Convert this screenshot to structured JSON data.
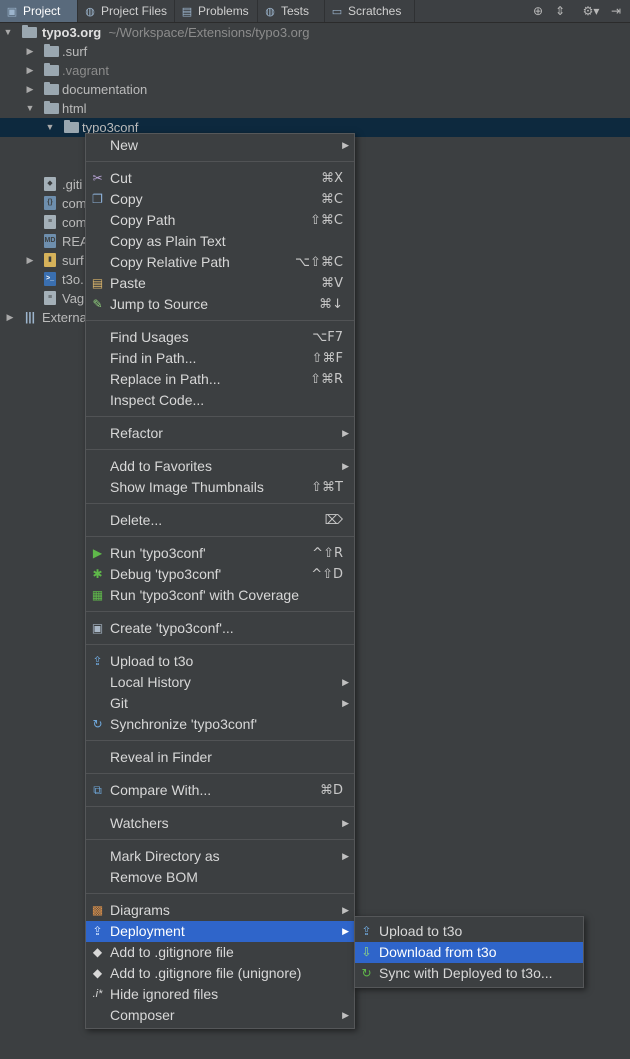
{
  "tabs": [
    {
      "label": "Project",
      "icon": "project-icon"
    },
    {
      "label": "Project Files",
      "icon": "globe-icon"
    },
    {
      "label": "Problems",
      "icon": "problems-icon"
    },
    {
      "label": "Tests",
      "icon": "globe-icon"
    },
    {
      "label": "Scratches",
      "icon": "scratches-icon"
    }
  ],
  "tree": {
    "root": {
      "name": "typo3.org",
      "path": "~/Workspace/Extensions/typo3.org"
    },
    "items": [
      {
        "label": ".surf"
      },
      {
        "label": ".vagrant"
      },
      {
        "label": "documentation"
      },
      {
        "label": "html"
      },
      {
        "label": "typo3conf"
      },
      {
        "label": ".giti"
      },
      {
        "label": "com"
      },
      {
        "label": "com"
      },
      {
        "label": "REA"
      },
      {
        "label": "surf"
      },
      {
        "label": "t3o."
      },
      {
        "label": "Vag"
      },
      {
        "label": "Externa"
      }
    ]
  },
  "context_menu": {
    "new": "New",
    "cut": {
      "label": "Cut",
      "shortcut": "⌘X"
    },
    "copy": {
      "label": "Copy",
      "shortcut": "⌘C"
    },
    "copy_path": {
      "label": "Copy Path",
      "shortcut": "⇧⌘C"
    },
    "copy_plain": {
      "label": "Copy as Plain Text"
    },
    "copy_relative": {
      "label": "Copy Relative Path",
      "shortcut": "⌥⇧⌘C"
    },
    "paste": {
      "label": "Paste",
      "shortcut": "⌘V"
    },
    "jump_source": {
      "label": "Jump to Source",
      "shortcut": "⌘↓"
    },
    "find_usages": {
      "label": "Find Usages",
      "shortcut": "⌥F7"
    },
    "find_in_path": {
      "label": "Find in Path...",
      "shortcut": "⇧⌘F"
    },
    "replace_in_path": {
      "label": "Replace in Path...",
      "shortcut": "⇧⌘R"
    },
    "inspect_code": {
      "label": "Inspect Code..."
    },
    "refactor": {
      "label": "Refactor"
    },
    "add_favorites": {
      "label": "Add to Favorites"
    },
    "show_thumbnails": {
      "label": "Show Image Thumbnails",
      "shortcut": "⇧⌘T"
    },
    "delete": {
      "label": "Delete...",
      "shortcut": "⌦"
    },
    "run": {
      "label": "Run 'typo3conf'",
      "shortcut": "^⇧R"
    },
    "debug": {
      "label": "Debug 'typo3conf'",
      "shortcut": "^⇧D"
    },
    "run_coverage": {
      "label": "Run 'typo3conf' with Coverage"
    },
    "create": {
      "label": "Create 'typo3conf'..."
    },
    "upload": {
      "label": "Upload to t3o"
    },
    "local_history": {
      "label": "Local History"
    },
    "git": {
      "label": "Git"
    },
    "synchronize": {
      "label": "Synchronize 'typo3conf'"
    },
    "reveal_finder": {
      "label": "Reveal in Finder"
    },
    "compare_with": {
      "label": "Compare With...",
      "shortcut": "⌘D"
    },
    "watchers": {
      "label": "Watchers"
    },
    "mark_directory": {
      "label": "Mark Directory as"
    },
    "remove_bom": {
      "label": "Remove BOM"
    },
    "diagrams": {
      "label": "Diagrams"
    },
    "deployment": {
      "label": "Deployment"
    },
    "add_gitignore": {
      "label": "Add to .gitignore file"
    },
    "add_gitignore_unignore": {
      "label": "Add to .gitignore file (unignore)"
    },
    "hide_ignored": {
      "label": "Hide ignored files",
      "icon_text": ".i*"
    },
    "composer": {
      "label": "Composer"
    }
  },
  "deployment_submenu": {
    "upload": "Upload to t3o",
    "download": "Download from t3o",
    "sync": "Sync with Deployed to t3o..."
  },
  "colors": {
    "background": "#3c3f41",
    "selection": "#2f65ca",
    "tree_selection": "#0d293e",
    "active_tab": "#596a7c"
  }
}
